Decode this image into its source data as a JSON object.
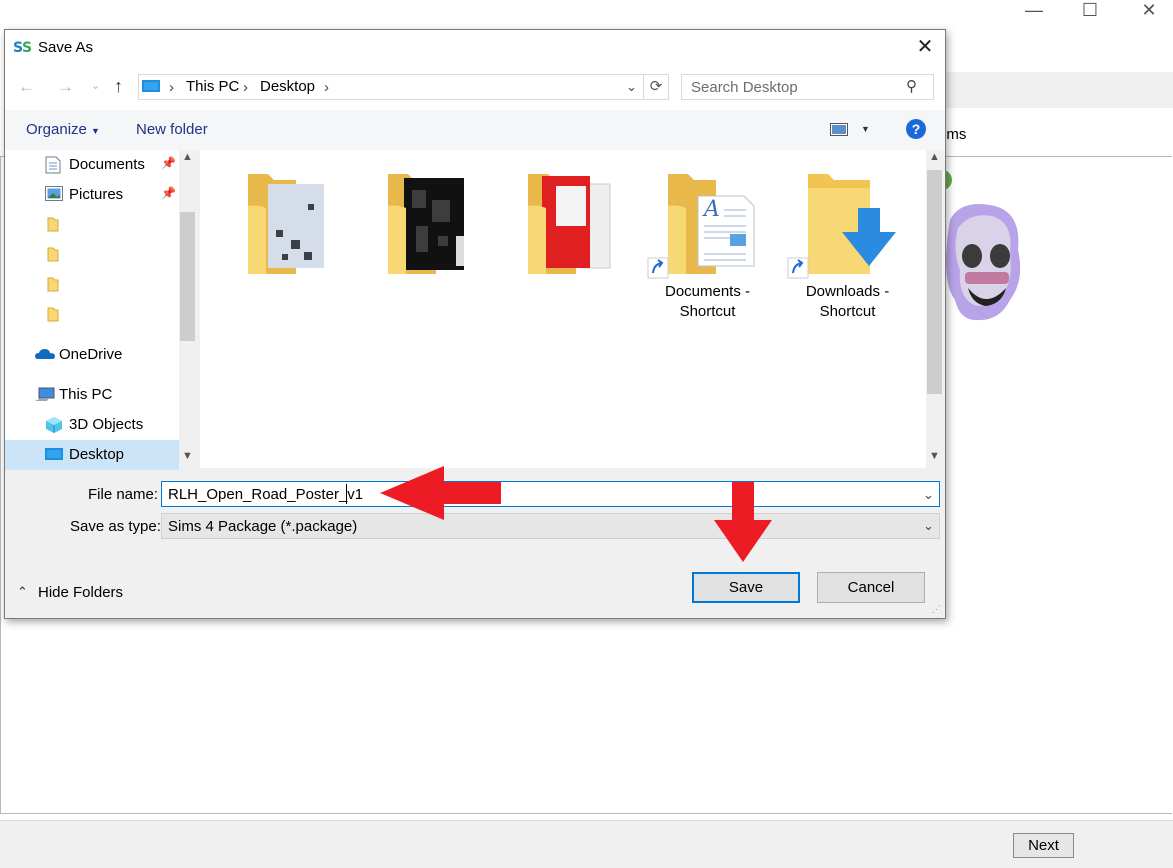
{
  "dialog": {
    "title": "Save As",
    "close_label": "✕",
    "address": {
      "segments": [
        "This PC",
        "Desktop"
      ]
    },
    "search_placeholder": "Search Desktop",
    "toolbar": {
      "organize_label": "Organize",
      "new_folder_label": "New folder",
      "help_label": "?"
    },
    "nav_items": [
      {
        "label": "Documents",
        "pinned": true
      },
      {
        "label": "Pictures",
        "pinned": true
      },
      {
        "label": ""
      },
      {
        "label": ""
      },
      {
        "label": ""
      },
      {
        "label": ""
      },
      {
        "label": "OneDrive"
      },
      {
        "label": "This PC"
      },
      {
        "label": "3D Objects"
      },
      {
        "label": "Desktop",
        "selected": true
      }
    ],
    "files": [
      {
        "name": ""
      },
      {
        "name": ""
      },
      {
        "name": ""
      },
      {
        "name": "Documents -\nShortcut",
        "line1": "Documents -",
        "line2": "Shortcut"
      },
      {
        "name": "Downloads -\nShortcut",
        "line1": "Downloads -",
        "line2": "Shortcut"
      }
    ],
    "file_name_label": "File name:",
    "file_name_value": "RLH_Open_Road_Poster_v1",
    "save_type_label": "Save as type:",
    "save_type_value": "Sims 4 Package (*.package)",
    "hide_folders_label": "Hide Folders",
    "save_label": "Save",
    "cancel_label": "Cancel"
  },
  "background_app": {
    "tab_fragment": "ems",
    "next_label": "Next"
  },
  "colors": {
    "accent": "#0078d7",
    "annotation_arrow": "#ed1c24",
    "folder": "#f8d775",
    "selection": "#cce4f7"
  }
}
